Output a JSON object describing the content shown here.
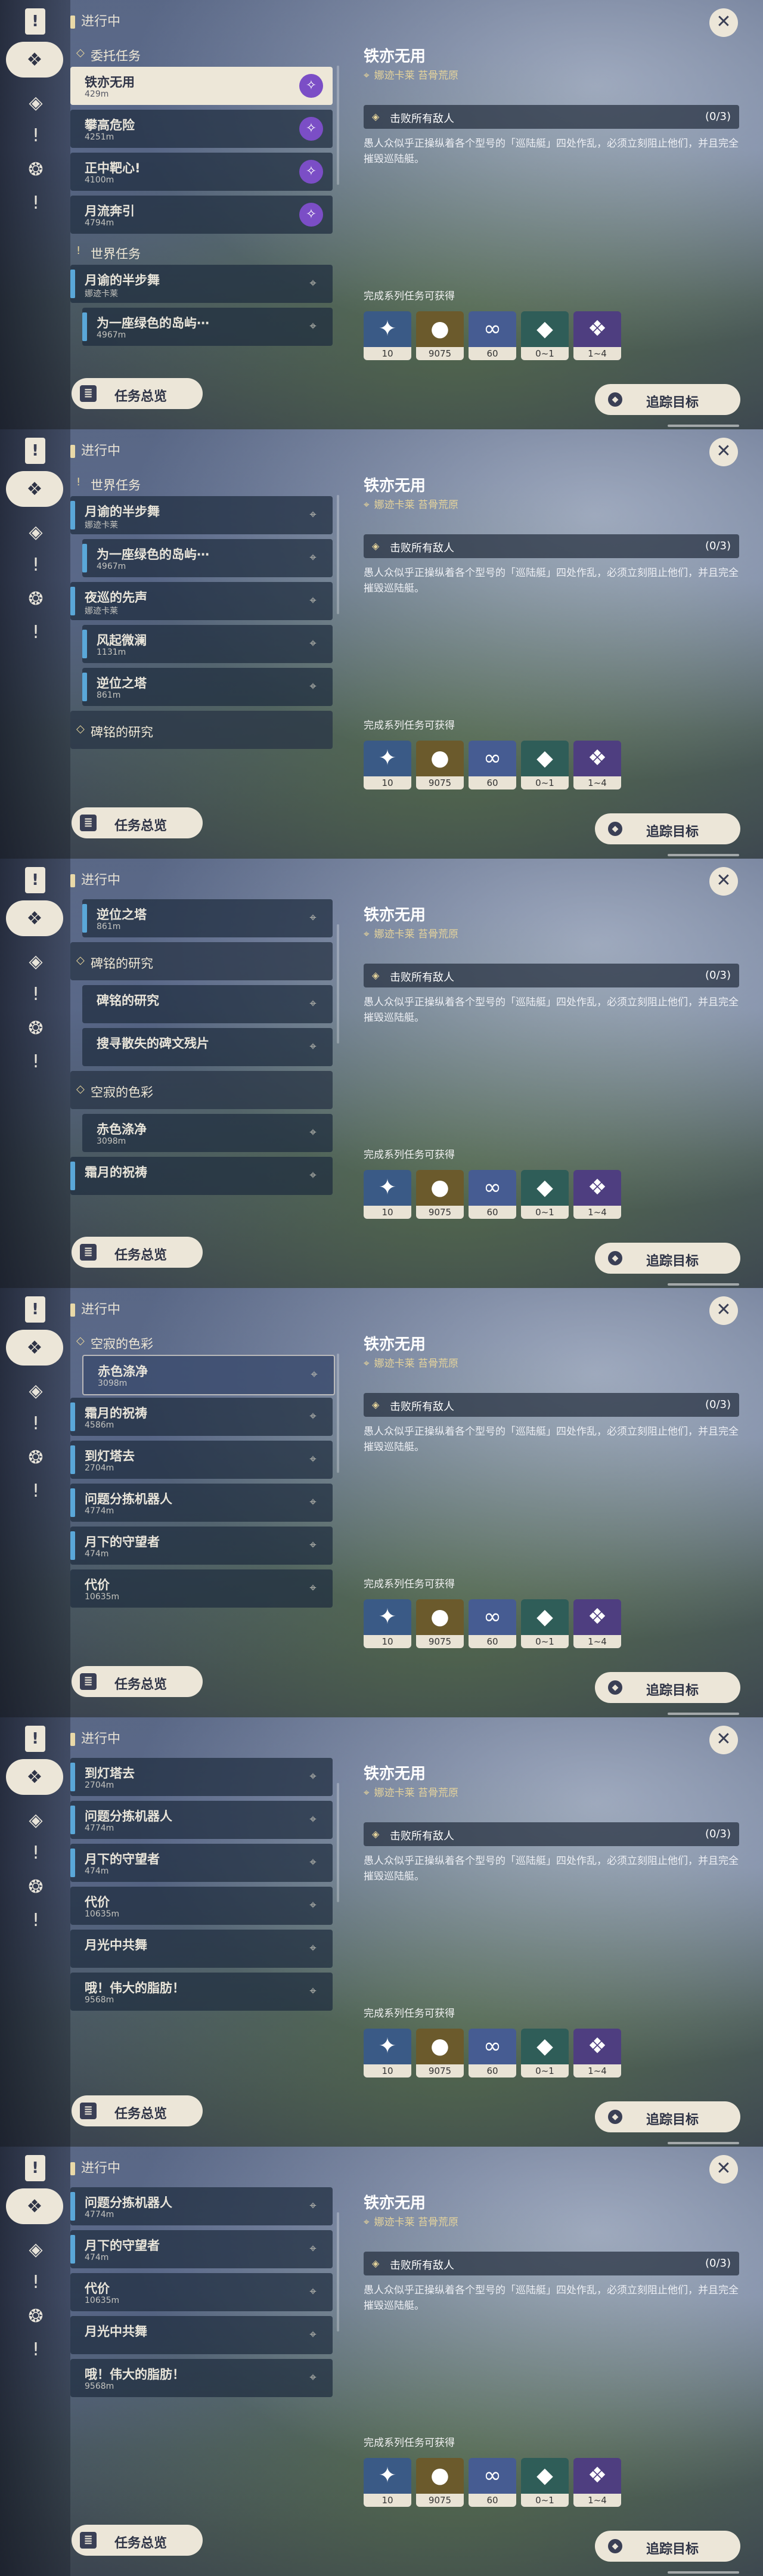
{
  "list": {
    "in_progress_label": "进行中",
    "bottom_button": "任务总览"
  },
  "detail": {
    "title": "铁亦无用",
    "location": "娜迹卡莱 苔骨荒原",
    "objective": {
      "text": "击败所有敌人",
      "count": "(0/3)"
    },
    "description": "愚人众似乎正操纵着各个型号的「巡陆艇」四处作乱，必须立刻阻止他们，并且完全摧毁巡陆艇。",
    "rewards_label": "完成系列任务可获得",
    "rewards": [
      {
        "icon": "adventure-exp-icon",
        "count": "10",
        "color": "#3a5a86"
      },
      {
        "icon": "mora-icon",
        "count": "9075",
        "color": "#6b5a2c"
      },
      {
        "icon": "companionship-exp-icon",
        "count": "60",
        "color": "#465c92"
      },
      {
        "icon": "crystal-icon",
        "count": "0~1",
        "color": "#2f5d58"
      },
      {
        "icon": "crystal-ore-icon",
        "count": "1~4",
        "color": "#4e3e80"
      }
    ],
    "track_button": "追踪目标"
  },
  "frames": [
    {
      "items": [
        {
          "kind": "section",
          "text": "委托任务"
        },
        {
          "kind": "row",
          "title": "铁亦无用",
          "sub": "429m",
          "selected": true,
          "gem": true
        },
        {
          "kind": "row",
          "title": "攀高危险",
          "sub": "4251m",
          "gem": true
        },
        {
          "kind": "row",
          "title": "正中靶心!",
          "sub": "4100m",
          "gem": true
        },
        {
          "kind": "row",
          "title": "月流奔引",
          "sub": "4794m",
          "gem": true
        },
        {
          "kind": "section",
          "text": "世界任务",
          "mark": "!"
        },
        {
          "kind": "row",
          "title": "月谕的半步舞",
          "sub": "娜迹卡莱",
          "bar": true,
          "pin": true
        },
        {
          "kind": "row",
          "title": "为一座绿色的岛屿⋯",
          "sub": "4967m",
          "bar": true,
          "indent": true,
          "pin": true
        }
      ]
    },
    {
      "items": [
        {
          "kind": "section",
          "text": "世界任务",
          "mark": "!"
        },
        {
          "kind": "row",
          "title": "月谕的半步舞",
          "sub": "娜迹卡莱",
          "bar": true,
          "pin": true
        },
        {
          "kind": "row",
          "title": "为一座绿色的岛屿⋯",
          "sub": "4967m",
          "bar": true,
          "indent": true,
          "pin": true
        },
        {
          "kind": "row",
          "title": "夜巡的先声",
          "sub": "娜迹卡莱",
          "bar": true,
          "pin": true
        },
        {
          "kind": "row",
          "title": "风起微澜",
          "sub": "1131m",
          "bar": true,
          "indent": true,
          "pin": true
        },
        {
          "kind": "row",
          "title": "逆位之塔",
          "sub": "861m",
          "bar": true,
          "indent": true,
          "pin": true
        },
        {
          "kind": "group",
          "text": "碑铭的研究"
        }
      ]
    },
    {
      "items": [
        {
          "kind": "row",
          "title": "逆位之塔",
          "sub": "861m",
          "bar": true,
          "indent": true,
          "pin": true
        },
        {
          "kind": "group",
          "text": "碑铭的研究"
        },
        {
          "kind": "row",
          "title": "碑铭的研究",
          "sub": "",
          "indent": true,
          "pin": true
        },
        {
          "kind": "row",
          "title": "搜寻散失的碑文残片",
          "sub": "",
          "indent": true,
          "pin": true
        },
        {
          "kind": "group",
          "text": "空寂的色彩"
        },
        {
          "kind": "row",
          "title": "赤色涤净",
          "sub": "3098m",
          "indent": true,
          "pin": true
        },
        {
          "kind": "row",
          "title": "霜月的祝祷",
          "sub": "",
          "bar": true,
          "pin": true
        }
      ]
    },
    {
      "items": [
        {
          "kind": "section",
          "text": "空寂的色彩"
        },
        {
          "kind": "row",
          "title": "赤色涤净",
          "sub": "3098m",
          "indent": true,
          "pin": true,
          "selectedDark": true
        },
        {
          "kind": "row",
          "title": "霜月的祝祷",
          "sub": "4586m",
          "bar": true,
          "pin": true
        },
        {
          "kind": "row",
          "title": "到灯塔去",
          "sub": "2704m",
          "bar": true,
          "pin": true
        },
        {
          "kind": "row",
          "title": "问题分拣机器人",
          "sub": "4774m",
          "bar": true,
          "pin": true
        },
        {
          "kind": "row",
          "title": "月下的守望者",
          "sub": "474m",
          "bar": true,
          "pin": true
        },
        {
          "kind": "row",
          "title": "代价",
          "sub": "10635m",
          "pin": true
        }
      ]
    },
    {
      "items": [
        {
          "kind": "row",
          "title": "到灯塔去",
          "sub": "2704m",
          "bar": true,
          "pin": true
        },
        {
          "kind": "row",
          "title": "问题分拣机器人",
          "sub": "4774m",
          "bar": true,
          "pin": true
        },
        {
          "kind": "row",
          "title": "月下的守望者",
          "sub": "474m",
          "bar": true,
          "pin": true
        },
        {
          "kind": "row",
          "title": "代价",
          "sub": "10635m",
          "pin": true
        },
        {
          "kind": "row",
          "title": "月光中共舞",
          "sub": "",
          "pin": true
        },
        {
          "kind": "row",
          "title": "哦！伟大的脂肪！",
          "sub": "9568m",
          "pin": true
        }
      ]
    },
    {
      "items": [
        {
          "kind": "row",
          "title": "问题分拣机器人",
          "sub": "4774m",
          "bar": true,
          "pin": true
        },
        {
          "kind": "row",
          "title": "月下的守望者",
          "sub": "474m",
          "bar": true,
          "pin": true
        },
        {
          "kind": "row",
          "title": "代价",
          "sub": "10635m",
          "pin": true
        },
        {
          "kind": "row",
          "title": "月光中共舞",
          "sub": "",
          "pin": true
        },
        {
          "kind": "row",
          "title": "哦！伟大的脂肪！",
          "sub": "9568m",
          "pin": true
        }
      ]
    }
  ]
}
